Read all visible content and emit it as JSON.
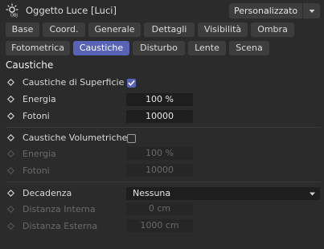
{
  "header": {
    "title": "Oggetto Luce [Luci]",
    "preset_value": "Personalizzato",
    "object_icon": "light-object-icon",
    "caret_icon": "chevron-down-icon"
  },
  "tabs": [
    {
      "label": "Base",
      "active": false
    },
    {
      "label": "Coord.",
      "active": false
    },
    {
      "label": "Generale",
      "active": false
    },
    {
      "label": "Dettagli",
      "active": false
    },
    {
      "label": "Visibilità",
      "active": false
    },
    {
      "label": "Ombra",
      "active": false
    },
    {
      "label": "Fotometrica",
      "active": false
    },
    {
      "label": "Caustiche",
      "active": true
    },
    {
      "label": "Disturbo",
      "active": false
    },
    {
      "label": "Lente",
      "active": false
    },
    {
      "label": "Scena",
      "active": false
    }
  ],
  "section": {
    "title": "Caustiche"
  },
  "params": {
    "surface_caustics": {
      "label": "Caustiche di Superficie",
      "checked": true
    },
    "surface_energy": {
      "label": "Energia",
      "value": "100 %"
    },
    "surface_photons": {
      "label": "Fotoni",
      "value": "10000"
    },
    "volume_caustics": {
      "label": "Caustiche Volumetriche",
      "checked": false
    },
    "volume_energy": {
      "label": "Energia",
      "value": "100 %"
    },
    "volume_photons": {
      "label": "Fotoni",
      "value": "10000"
    },
    "falloff": {
      "label": "Decadenza",
      "value": "Nessuna"
    },
    "inner_distance": {
      "label": "Distanza Interna",
      "value": "0 cm"
    },
    "outer_distance": {
      "label": "Distanza Esterna",
      "value": "1000 cm"
    }
  },
  "colors": {
    "accent": "#5863b6",
    "background": "#2b2b2b",
    "field": "#1e1e1e"
  }
}
